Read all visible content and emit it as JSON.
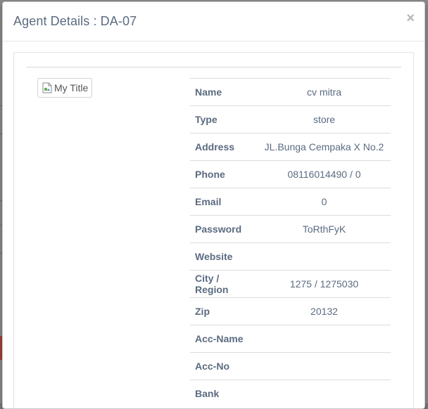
{
  "modal": {
    "title": "Agent Details : DA-07",
    "close_label": "×"
  },
  "agent_image": {
    "alt": "My Title"
  },
  "details": [
    {
      "label": "Name",
      "value": "cv mitra"
    },
    {
      "label": "Type",
      "value": "store"
    },
    {
      "label": "Address",
      "value": "JL.Bunga Cempaka X No.2"
    },
    {
      "label": "Phone",
      "value": "08116014490 / 0"
    },
    {
      "label": "Email",
      "value": "0"
    },
    {
      "label": "Password",
      "value": "ToRthFyK"
    },
    {
      "label": "Website",
      "value": ""
    },
    {
      "label": "City / Region",
      "value": "1275 / 1275030"
    },
    {
      "label": "Zip",
      "value": "20132"
    },
    {
      "label": "Acc-Name",
      "value": ""
    },
    {
      "label": "Acc-No",
      "value": ""
    },
    {
      "label": "Bank",
      "value": ""
    }
  ],
  "colors": {
    "text": "#5b6b80",
    "close": "#b5b5b5",
    "backdrop": "#8c8c8c"
  }
}
